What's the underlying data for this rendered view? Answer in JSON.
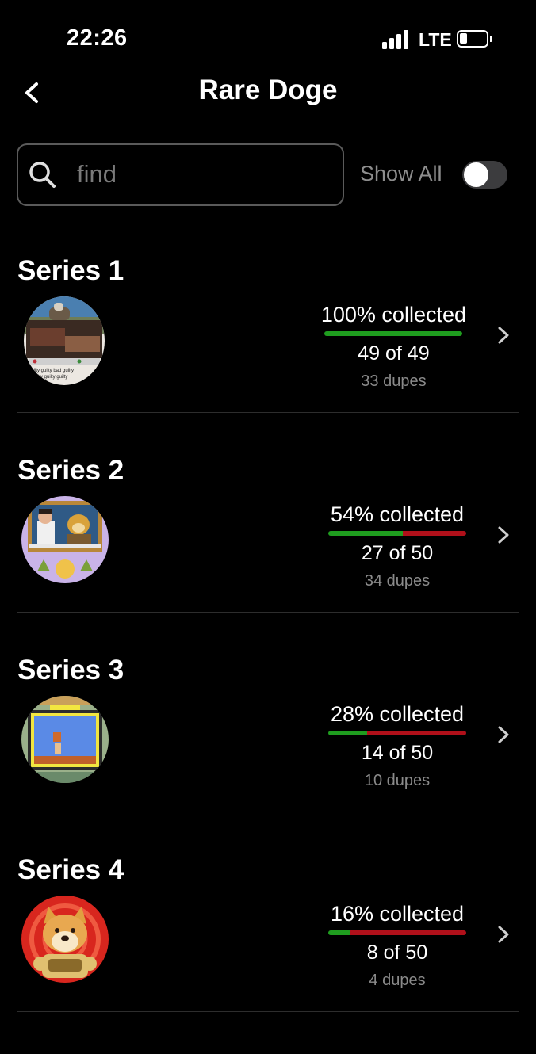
{
  "status_bar": {
    "time": "22:26",
    "network": "LTE"
  },
  "header": {
    "title": "Rare Doge"
  },
  "search": {
    "placeholder": "find",
    "value": ""
  },
  "filter": {
    "show_all_label": "Show All",
    "show_all_enabled": false
  },
  "colors": {
    "collected": "#1f9d1f",
    "missing": "#b0101a",
    "background": "#000000"
  },
  "series": [
    {
      "title": "Series 1",
      "percent_label": "100% collected",
      "percent": 100,
      "count_label": "49 of 49",
      "dupes_label": "33 dupes",
      "thumbnail": "dog-on-couch-card"
    },
    {
      "title": "Series 2",
      "percent_label": "54% collected",
      "percent": 54,
      "count_label": "27 of 50",
      "dupes_label": "34 dupes",
      "thumbnail": "doge-dinner-card"
    },
    {
      "title": "Series 3",
      "percent_label": "28% collected",
      "percent": 28,
      "count_label": "14 of 50",
      "dupes_label": "10 dupes",
      "thumbnail": "pixel-game-doge-card"
    },
    {
      "title": "Series 4",
      "percent_label": "16% collected",
      "percent": 16,
      "count_label": "8 of 50",
      "dupes_label": "4 dupes",
      "thumbnail": "astronaut-doge-card"
    }
  ]
}
